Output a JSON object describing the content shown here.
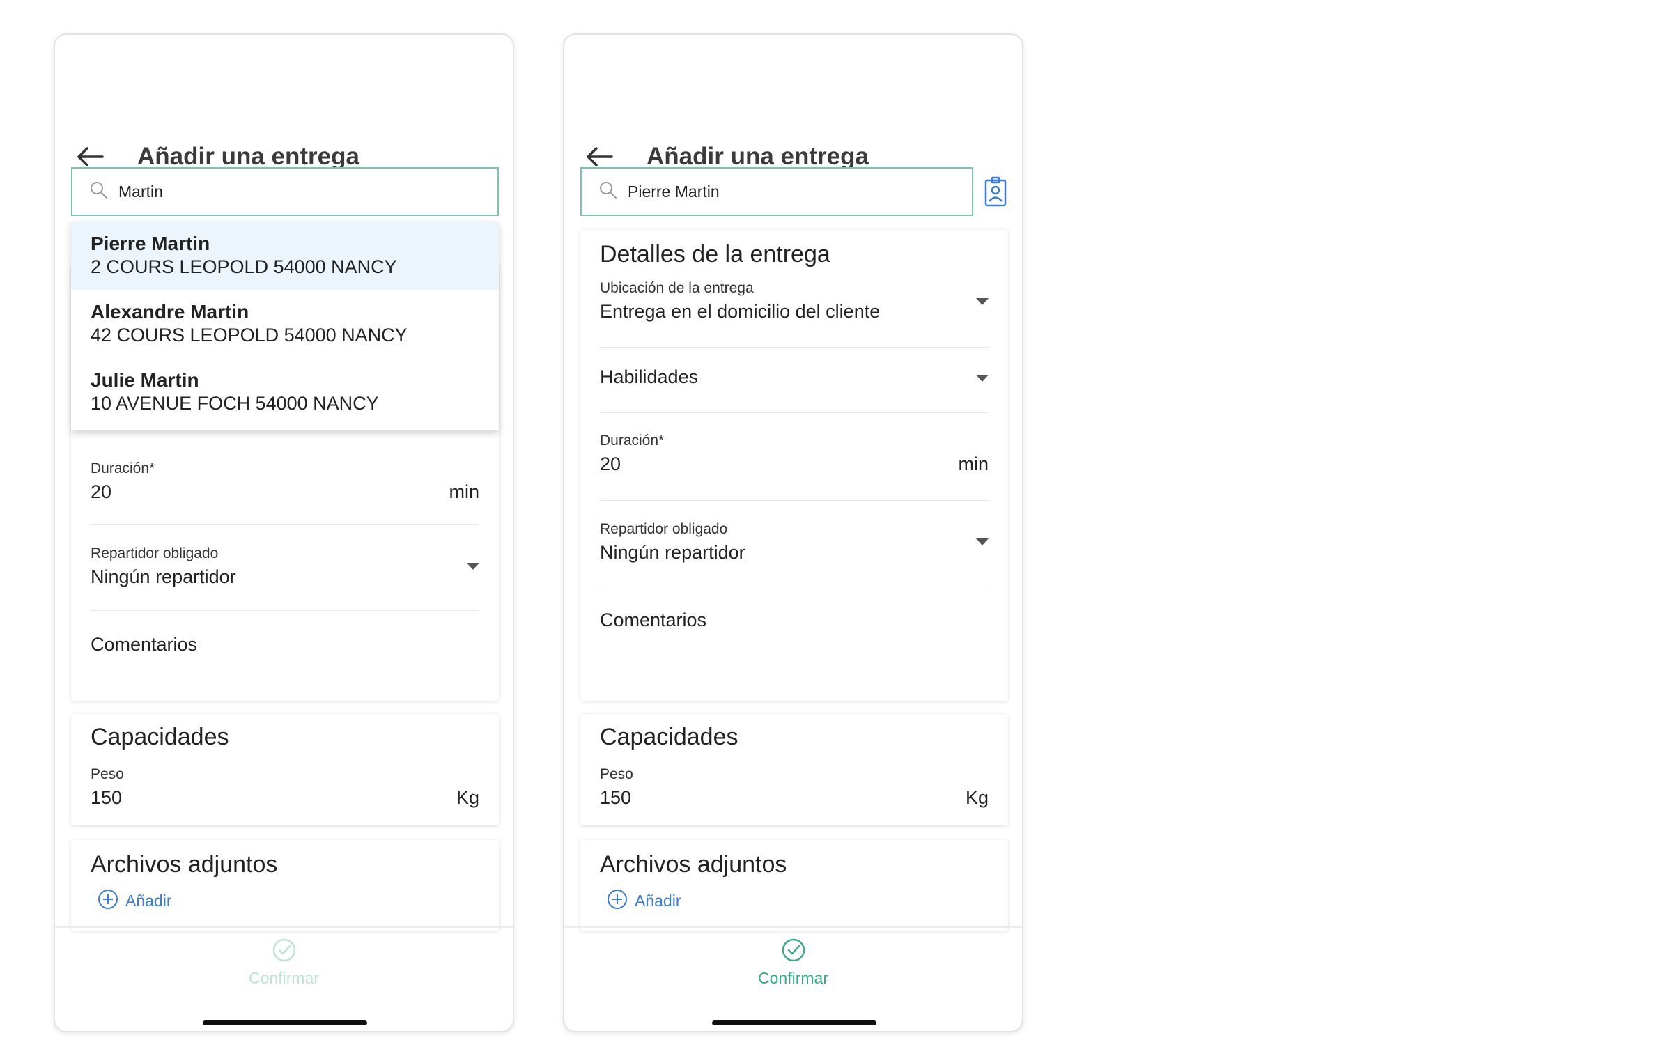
{
  "screens": {
    "left": {
      "title": "Añadir una entrega",
      "search_value": "Martin",
      "suggestions": [
        {
          "name": "Pierre Martin",
          "address": "2 COURS LEOPOLD 54000 NANCY"
        },
        {
          "name": "Alexandre Martin",
          "address": "42 COURS LEOPOLD 54000 NANCY"
        },
        {
          "name": "Julie Martin",
          "address": "10 AVENUE FOCH 54000 NANCY"
        }
      ],
      "confirm_label": "Confirmar",
      "confirm_enabled": false
    },
    "right": {
      "title": "Añadir una entrega",
      "search_value": "Pierre Martin",
      "confirm_label": "Confirmar",
      "confirm_enabled": true
    }
  },
  "details": {
    "title": "Detalles de la entrega",
    "location_label": "Ubicación de la entrega",
    "location_value": "Entrega en el domicilio del cliente",
    "skills_label": "Habilidades",
    "duration_label": "Duración*",
    "duration_label_clipped": "Duración*",
    "duration_value": "20",
    "duration_unit": "min",
    "driver_label": "Repartidor obligado",
    "driver_value": "Ningún repartidor",
    "comments_label": "Comentarios"
  },
  "capacities": {
    "title": "Capacidades",
    "weight_label": "Peso",
    "weight_value": "150",
    "weight_unit": "Kg"
  },
  "attachments": {
    "title": "Archivos adjuntos",
    "add_label": "Añadir"
  },
  "colors": {
    "search_border": "#7cc3b4",
    "accent_blue": "#3a7bd5",
    "confirm_active": "#3aaa8f",
    "confirm_disabled": "#bfe3da",
    "highlight_row": "#edf5fc"
  }
}
